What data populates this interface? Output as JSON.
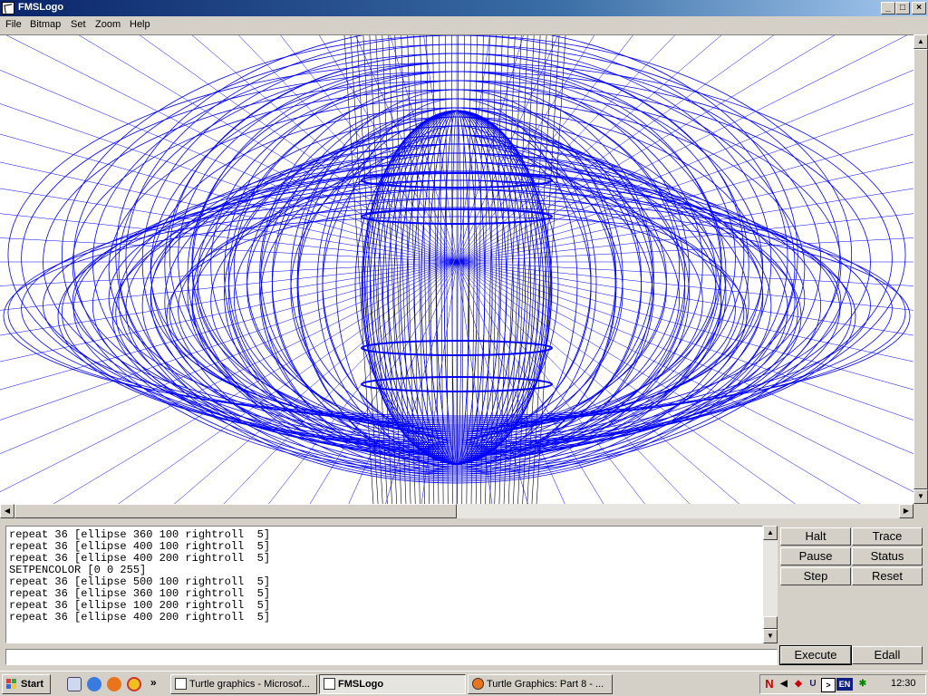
{
  "window": {
    "title": "FMSLogo"
  },
  "title_buttons": {
    "minimize": "_",
    "maximize": "□",
    "close": "×"
  },
  "menu": [
    "File",
    "Bitmap",
    "Set",
    "Zoom",
    "Help"
  ],
  "history": [
    "repeat 36 [ellipse 360 100 rightroll  5]",
    "repeat 36 [ellipse 400 100 rightroll  5]",
    "repeat 36 [ellipse 400 200 rightroll  5]",
    "SETPENCOLOR [0 0 255]",
    "repeat 36 [ellipse 500 100 rightroll  5]",
    "repeat 36 [ellipse 360 100 rightroll  5]",
    "repeat 36 [ellipse 100 200 rightroll  5]",
    "repeat 36 [ellipse 400 200 rightroll  5]"
  ],
  "command_input": {
    "value": ""
  },
  "buttons": {
    "halt": "Halt",
    "trace": "Trace",
    "pause": "Pause",
    "status": "Status",
    "step": "Step",
    "reset": "Reset",
    "execute": "Execute",
    "edall": "Edall"
  },
  "taskbar": {
    "start": "Start",
    "overflow": "»",
    "tasks": [
      "Turtle graphics - Microsof...",
      "FMSLogo",
      "Turtle Graphics: Part 8 - ..."
    ],
    "language": "EN",
    "clock": "12:30"
  },
  "colors": {
    "pen_blue": "#0000ff",
    "pen_black": "#000000",
    "title_active": "#0a246a"
  }
}
